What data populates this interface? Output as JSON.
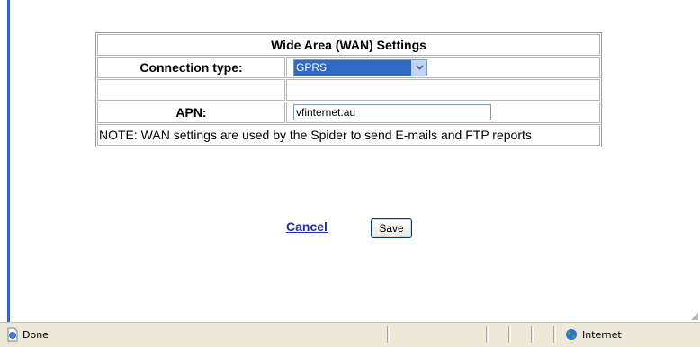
{
  "wan": {
    "title": "Wide Area (WAN) Settings",
    "connection_label": "Connection type:",
    "connection_value": "GPRS",
    "apn_label": "APN:",
    "apn_value": "vfinternet.au",
    "note": "NOTE: WAN settings are used by the Spider to send E-mails and FTP reports"
  },
  "actions": {
    "cancel_label": "Cancel",
    "save_label": "Save"
  },
  "status": {
    "left_text": "Done",
    "zone_text": "Internet"
  },
  "colors": {
    "select_highlight": "#316ac5",
    "link": "#1f2fa4",
    "status_bar": "#ece9d8"
  },
  "icons": {
    "dropdown": "chevron-down-icon",
    "page": "page-icon",
    "zone": "globe-icon"
  }
}
